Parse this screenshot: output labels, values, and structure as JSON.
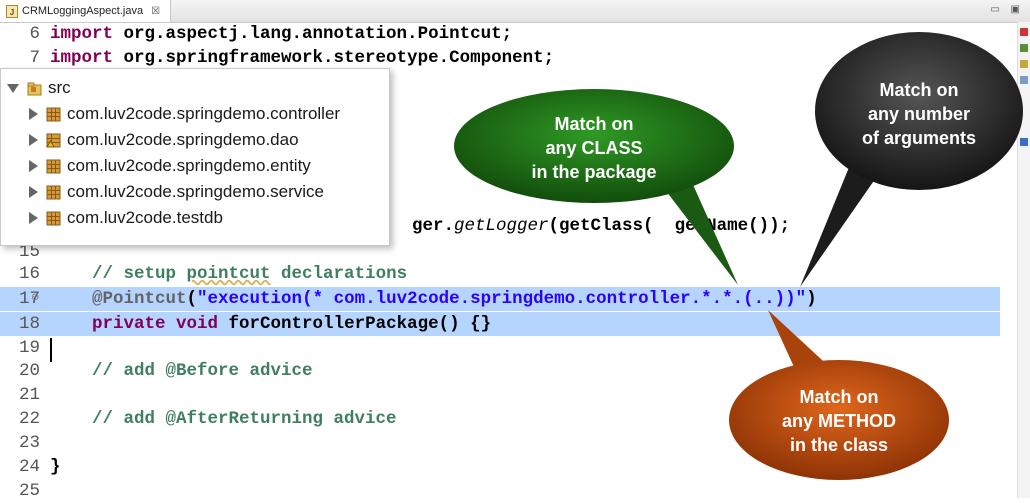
{
  "tab": {
    "title": "CRMLoggingAspect.java",
    "close": "☒"
  },
  "window_controls": "▭ ▣",
  "code_lines": [
    {
      "n": "6",
      "segments": [
        {
          "t": "import ",
          "c": "kw"
        },
        {
          "t": "org.aspectj.lang.annotation.Pointcut;",
          "c": "bd"
        }
      ]
    },
    {
      "n": "7",
      "segments": [
        {
          "t": "import ",
          "c": "kw"
        },
        {
          "t": "org.springframework.stereotype.Component;",
          "c": "bd"
        }
      ]
    },
    {
      "n": "",
      "segments": [
        {
          "t": "ger.",
          "c": "bd"
        },
        {
          "t": "getLogger",
          "c": "it"
        },
        {
          "t": "(getClass(",
          "c": "bd"
        },
        {
          "t": "  ",
          "c": ""
        },
        {
          "t": "getName());",
          "c": "bd"
        }
      ]
    },
    {
      "n": "15",
      "segments": []
    },
    {
      "n": "16",
      "segments": [
        {
          "t": "    // setup ",
          "c": "cm"
        },
        {
          "t": "pointcut",
          "c": "cm ul"
        },
        {
          "t": " declarations",
          "c": "cm"
        }
      ]
    },
    {
      "n": "17",
      "segments": [
        {
          "t": "    ",
          "c": ""
        },
        {
          "t": "@Pointcut",
          "c": "an"
        },
        {
          "t": "(",
          "c": "bd"
        },
        {
          "t": "\"execution(* com.luv2code.springdemo.controller.*.*.(..))\"",
          "c": "st"
        },
        {
          "t": ")",
          "c": "bd"
        }
      ]
    },
    {
      "n": "18",
      "segments": [
        {
          "t": "    ",
          "c": ""
        },
        {
          "t": "private void ",
          "c": "kw"
        },
        {
          "t": "forControllerPackage() {}",
          "c": "bd"
        }
      ]
    },
    {
      "n": "19",
      "segments": []
    },
    {
      "n": "20",
      "segments": [
        {
          "t": "    // add @Before advice",
          "c": "cm"
        }
      ]
    },
    {
      "n": "21",
      "segments": []
    },
    {
      "n": "22",
      "segments": [
        {
          "t": "    // add @AfterReturning advice",
          "c": "cm"
        }
      ]
    },
    {
      "n": "23",
      "segments": []
    },
    {
      "n": "24",
      "segments": [
        {
          "t": "}",
          "c": "bd"
        }
      ]
    },
    {
      "n": "25",
      "segments": []
    }
  ],
  "tree": {
    "root": "src",
    "packages": [
      "com.luv2code.springdemo.controller",
      "com.luv2code.springdemo.dao",
      "com.luv2code.springdemo.entity",
      "com.luv2code.springdemo.service",
      "com.luv2code.testdb"
    ]
  },
  "callouts": {
    "class": {
      "lines": [
        "Match on",
        "any CLASS",
        "in the package"
      ],
      "color": "#1b6a14"
    },
    "args": {
      "lines": [
        "Match on",
        "any number",
        "of arguments"
      ],
      "color": "#2b2b2b"
    },
    "method": {
      "lines": [
        "Match on",
        "any METHOD",
        "in the class"
      ],
      "color": "#b5470b"
    }
  },
  "colors": {
    "selection": "#b5d5ff",
    "keyword": "#7f0055",
    "comment": "#3f7f5f",
    "string": "#2a00ff"
  }
}
